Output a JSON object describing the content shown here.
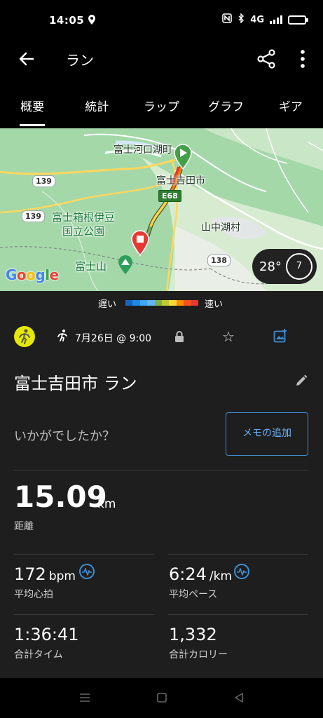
{
  "status": {
    "time": "14:05",
    "network": "4G"
  },
  "appbar": {
    "title": "ラン"
  },
  "tabs": [
    {
      "label": "概要",
      "active": true
    },
    {
      "label": "統計",
      "active": false
    },
    {
      "label": "ラップ",
      "active": false
    },
    {
      "label": "グラフ",
      "active": false
    },
    {
      "label": "ギア",
      "active": false
    }
  ],
  "map": {
    "labels": {
      "kawaguchiko": "富士河口湖町",
      "fujiyoshida": "富士吉田市",
      "park": "富士箱根伊豆\n国立公園",
      "yamanakako": "山中湖村",
      "fujisan": "富士山"
    },
    "roads": {
      "r139a": "139",
      "r139b": "139",
      "e68": "E68",
      "r138": "138"
    },
    "google": "Google",
    "weather": {
      "temp": "28°",
      "wind": "7"
    },
    "legend": {
      "slow": "遅い",
      "fast": "速い",
      "colors": [
        "#1565c0",
        "#1e88e5",
        "#42a5f5",
        "#64b5f6",
        "#7cb342",
        "#c0ca33",
        "#fdd835",
        "#fb8c00",
        "#f4511e",
        "#e53935"
      ]
    }
  },
  "activity": {
    "date": "7月26日 @ 9:00",
    "title": "富士吉田市 ラン",
    "feel_prompt": "いかがでしたか？",
    "memo_button": "メモの追加",
    "distance": {
      "value": "15.09",
      "unit": "km",
      "label": "距離"
    },
    "heart_rate": {
      "value": "172",
      "unit": "bpm",
      "label": "平均心拍"
    },
    "pace": {
      "value": "6:24",
      "unit": "/km",
      "label": "平均ペース"
    },
    "time": {
      "value": "1:36:41",
      "label": "合計タイム"
    },
    "calories": {
      "value": "1,332",
      "label": "合計カロリー"
    }
  },
  "colors": {
    "accent": "#3d8fd4",
    "activity_icon": "#e5e800",
    "background": "#1e1e1e"
  }
}
